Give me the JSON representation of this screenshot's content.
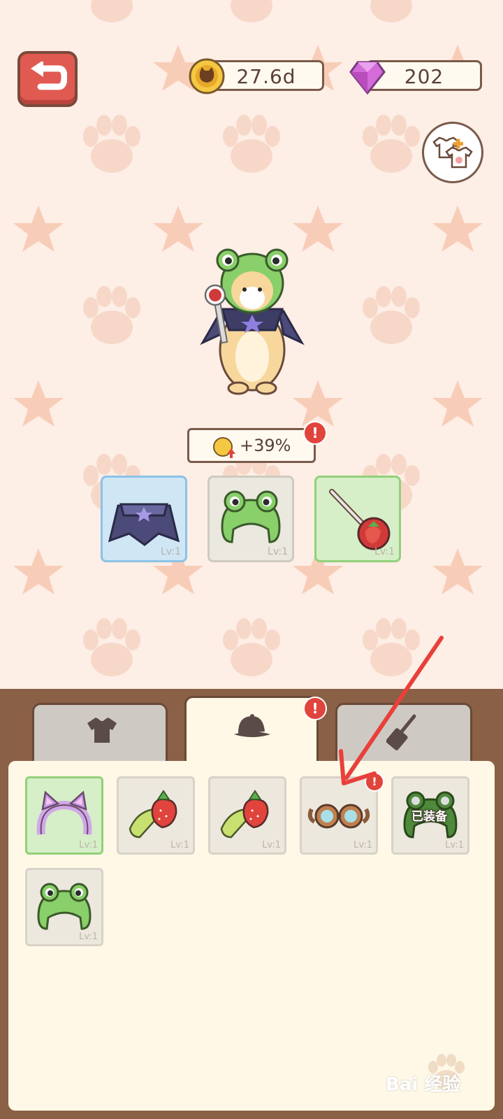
{
  "currencies": {
    "coins": "27.6d",
    "gems": "202"
  },
  "bonus": {
    "text": "+39%"
  },
  "equipped_slots": [
    {
      "item": "cape",
      "level": "Lv:1"
    },
    {
      "item": "frog-hat",
      "level": "Lv:1"
    },
    {
      "item": "strawberry-spoon",
      "level": "Lv:1"
    }
  ],
  "tabs": [
    {
      "name": "clothes",
      "icon": "shirt-icon",
      "active": false
    },
    {
      "name": "hats",
      "icon": "cap-icon",
      "active": true
    },
    {
      "name": "tools",
      "icon": "spatula-icon",
      "active": false
    }
  ],
  "items": [
    {
      "item": "cat-ear-headband",
      "level": "Lv:1",
      "selected": true
    },
    {
      "item": "strawberry-hairclip",
      "level": "Lv:1"
    },
    {
      "item": "strawberry-hairclip",
      "level": "Lv:1"
    },
    {
      "item": "goggles",
      "level": "Lv:1",
      "alert": true
    },
    {
      "item": "frog-hat",
      "level": "Lv:1",
      "equipped_label": "已装备"
    },
    {
      "item": "frog-hat",
      "level": "Lv:1"
    }
  ],
  "alert_symbol": "!",
  "watermark": "Bai 经验",
  "colors": {
    "back_button": "#e05a52",
    "alert": "#e0443c",
    "arrow": "#e8403a",
    "selected_green": "#d6efc8",
    "selected_blue": "#cfe6f5"
  }
}
